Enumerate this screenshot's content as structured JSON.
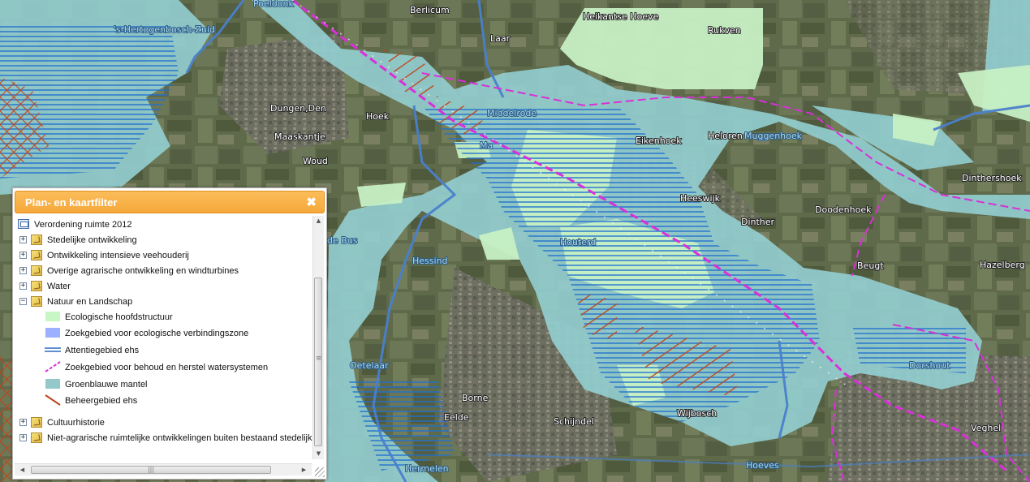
{
  "map": {
    "colors": {
      "aerial": "#5f6a4c",
      "ehs": "#c7f0c4",
      "groenblauwe_mantel": "#93cfd2",
      "attentie_lines": "#1f6fd0",
      "zoekgebied_watersystemen": "#d930d9",
      "beheergebied": "#c0451c",
      "river": "#4a80cc"
    },
    "place_labels": [
      {
        "name": "'s-Hertogenbosch-Zuid",
        "style": "water"
      },
      {
        "name": "Poeldonk",
        "style": "land"
      },
      {
        "name": "Berlicum",
        "style": "land"
      },
      {
        "name": "Laar",
        "style": "land"
      },
      {
        "name": "Heikantse Hoeve",
        "style": "land"
      },
      {
        "name": "Rukven",
        "style": "land"
      },
      {
        "name": "Dungen,Den",
        "style": "land"
      },
      {
        "name": "Maaskantje",
        "style": "land"
      },
      {
        "name": "Woud",
        "style": "land"
      },
      {
        "name": "Hoek",
        "style": "land"
      },
      {
        "name": "Middelrode",
        "style": "water"
      },
      {
        "name": "Eikenhoek",
        "style": "land"
      },
      {
        "name": "Heloren",
        "style": "land"
      },
      {
        "name": "Muggenhoek",
        "style": "water"
      },
      {
        "name": "Dinthershoek",
        "style": "land"
      },
      {
        "name": "Heeswijk",
        "style": "land"
      },
      {
        "name": "Dinther",
        "style": "land"
      },
      {
        "name": "Doodenhoek",
        "style": "land"
      },
      {
        "name": "Houterd",
        "style": "water"
      },
      {
        "name": "Hazelberg",
        "style": "land"
      },
      {
        "name": "Beugt",
        "style": "land"
      },
      {
        "name": "de Bus",
        "style": "land"
      },
      {
        "name": "Hessind",
        "style": "water"
      },
      {
        "name": "Oetelaar",
        "style": "water"
      },
      {
        "name": "Borne",
        "style": "land"
      },
      {
        "name": "Eelde",
        "style": "land"
      },
      {
        "name": "Schijndel",
        "style": "land"
      },
      {
        "name": "Wijbosch",
        "style": "land"
      },
      {
        "name": "Dorshout",
        "style": "water"
      },
      {
        "name": "Veghel",
        "style": "land"
      },
      {
        "name": "Hermelen",
        "style": "water"
      },
      {
        "name": "Hoeves",
        "style": "water"
      },
      {
        "name": "Ma",
        "style": "water"
      }
    ]
  },
  "panel": {
    "title": "Plan- en kaartfilter",
    "close_icon": "close-icon",
    "root_label": "Verordening ruimte 2012",
    "layers": [
      {
        "label": "Stedelijke ontwikkeling",
        "expanded": false
      },
      {
        "label": "Ontwikkeling intensieve veehouderij",
        "expanded": false
      },
      {
        "label": "Overige agrarische ontwikkeling en windturbines",
        "expanded": false
      },
      {
        "label": "Water",
        "expanded": false
      },
      {
        "label": "Natuur en Landschap",
        "expanded": true
      }
    ],
    "legend": [
      {
        "label": "Ecologische hoofdstructuur",
        "symbol": "fill",
        "color": "#c7f7c2"
      },
      {
        "label": "Zoekgebied voor ecologische verbindingszone",
        "symbol": "fill",
        "color": "#9bb0ff"
      },
      {
        "label": "Attentiegebied ehs",
        "symbol": "double-line",
        "color": "#2b6cc4"
      },
      {
        "label": "Zoekgebied voor behoud en herstel watersystemen",
        "symbol": "dashed-diagonal",
        "color": "#d930d9"
      },
      {
        "label": "Groenblauwe mantel",
        "symbol": "fill",
        "color": "#93c9c9"
      },
      {
        "label": "Beheergebied ehs",
        "symbol": "hatch",
        "color": "#c0451c"
      }
    ],
    "layers_after": [
      {
        "label": "Cultuurhistorie",
        "expanded": false
      },
      {
        "label": "Niet-agrarische ruimtelijke ontwikkelingen buiten bestaand stedelijk",
        "expanded": false
      }
    ]
  }
}
